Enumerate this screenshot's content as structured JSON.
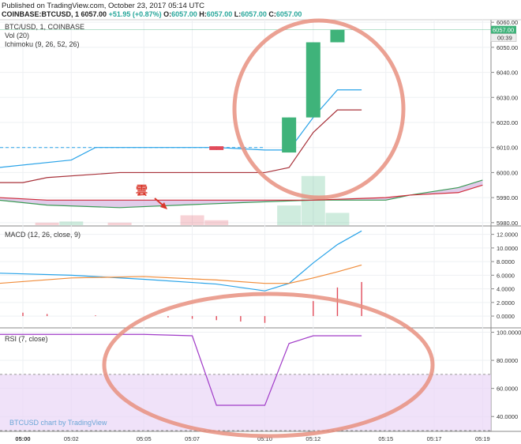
{
  "header": {
    "published": "Published on TradingView.com, October 23, 2017 05:14 UTC",
    "symbol": "COINBASE:BTCUSD, 1",
    "last": "6057.00",
    "change": "+51.95 (+0.87%)",
    "o_label": "O:",
    "o": "6057.00",
    "h_label": "H:",
    "h": "6057.00",
    "l_label": "L:",
    "l": "6057.00",
    "c_label": "C:",
    "c": "6057.00"
  },
  "price_pane": {
    "legend": [
      "BTC/USD, 1, COINBASE",
      "Vol (20)",
      "Ichimoku (9, 26, 52, 26)"
    ],
    "annotation": "雲",
    "price_tag": "6057.00",
    "countdown_tag": "00:39"
  },
  "macd_pane": {
    "legend": "MACD (12, 26, close, 9)"
  },
  "rsi_pane": {
    "legend": "RSI (7, close)"
  },
  "watermark": "BTCUSD chart by TradingView",
  "colors": {
    "up": "#3fb37a",
    "down": "#e14b5a",
    "tenkan": "#29a3e8",
    "kijun": "#a8323a",
    "cloud_fill": "#c9a3d8",
    "macd": "#29a3e8",
    "signal": "#f08c3a",
    "rsi": "#a13cc8",
    "highlight": "#e89080"
  },
  "chart_data": [
    {
      "type": "candlestick",
      "name": "price",
      "x": [
        "05:00",
        "05:01",
        "05:02",
        "05:03",
        "05:04",
        "05:05",
        "05:06",
        "05:07",
        "05:08",
        "05:09",
        "05:10",
        "05:11",
        "05:12",
        "05:13",
        "05:14"
      ],
      "x_ticks": [
        "05:00",
        "05:02",
        "05:05",
        "05:07",
        "05:10",
        "05:12",
        "05:15",
        "05:17",
        "05:19"
      ],
      "y_ticks": [
        5980,
        5990,
        6000,
        6010,
        6020,
        6030,
        6040,
        6050,
        6060
      ],
      "ylim": [
        5979,
        6061
      ],
      "candles": [
        {
          "t": "05:08",
          "o": 6010.5,
          "h": 6010.5,
          "l": 6009,
          "c": 6009
        },
        {
          "t": "05:11",
          "o": 6008,
          "h": 6022,
          "l": 6008,
          "c": 6022
        },
        {
          "t": "05:12",
          "o": 6022,
          "h": 6052,
          "l": 6022,
          "c": 6052
        },
        {
          "t": "05:13",
          "o": 6052,
          "h": 6057,
          "l": 6052,
          "c": 6057
        }
      ],
      "last_price": 6057.0,
      "tenkan": {
        "t": [
          "04:59",
          "05:02",
          "05:03",
          "05:08",
          "05:10",
          "05:11",
          "05:12",
          "05:13",
          "05:14"
        ],
        "v": [
          6002,
          6005,
          6010,
          6010,
          6009,
          6009,
          6022,
          6033,
          6033
        ]
      },
      "kijun": {
        "t": [
          "04:59",
          "05:00",
          "05:01",
          "05:04",
          "05:10",
          "05:11",
          "05:12",
          "05:13",
          "05:14"
        ],
        "v": [
          5996,
          5996,
          5998,
          6000,
          6000,
          6002,
          6016,
          6025,
          6025
        ]
      },
      "senkou_a": {
        "t": [
          "04:59",
          "05:01",
          "05:04",
          "05:09",
          "05:12",
          "05:15",
          "05:16",
          "05:18",
          "05:19"
        ],
        "v": [
          5989,
          5987,
          5986,
          5988,
          5989,
          5989,
          5991,
          5994,
          5997
        ]
      },
      "senkou_b": {
        "t": [
          "04:59",
          "05:01",
          "05:04",
          "05:09",
          "05:12",
          "05:15",
          "05:16",
          "05:18",
          "05:19"
        ],
        "v": [
          5990,
          5989,
          5989,
          5989,
          5989,
          5990,
          5991,
          5992,
          5995
        ]
      },
      "volume": [
        {
          "t": "05:01",
          "v": 2,
          "dir": "down"
        },
        {
          "t": "05:02",
          "v": 3,
          "dir": "up"
        },
        {
          "t": "05:04",
          "v": 2,
          "dir": "down"
        },
        {
          "t": "05:07",
          "v": 8,
          "dir": "down"
        },
        {
          "t": "05:08",
          "v": 4,
          "dir": "down"
        },
        {
          "t": "05:11",
          "v": 16,
          "dir": "up"
        },
        {
          "t": "05:12",
          "v": 40,
          "dir": "up"
        },
        {
          "t": "05:13",
          "v": 10,
          "dir": "up"
        }
      ]
    },
    {
      "type": "line",
      "name": "macd",
      "y_ticks": [
        0,
        2,
        4,
        6,
        8,
        10,
        12
      ],
      "ylim": [
        -1.5,
        13
      ],
      "macd": {
        "t": [
          "04:59",
          "05:02",
          "05:05",
          "05:08",
          "05:10",
          "05:11",
          "05:12",
          "05:13",
          "05:14"
        ],
        "v": [
          6.3,
          6.0,
          5.4,
          4.7,
          3.7,
          4.8,
          7.8,
          10.5,
          12.5
        ]
      },
      "signal": {
        "t": [
          "04:59",
          "05:02",
          "05:05",
          "05:08",
          "05:10",
          "05:11",
          "05:12",
          "05:13",
          "05:14"
        ],
        "v": [
          4.8,
          5.6,
          5.8,
          5.3,
          4.8,
          4.8,
          5.6,
          6.5,
          7.5
        ]
      },
      "histogram": [
        {
          "t": "05:00",
          "v": 0.5
        },
        {
          "t": "05:01",
          "v": 0.3
        },
        {
          "t": "05:03",
          "v": 0.1
        },
        {
          "t": "05:06",
          "v": -0.2
        },
        {
          "t": "05:07",
          "v": -0.4
        },
        {
          "t": "05:08",
          "v": -0.6
        },
        {
          "t": "05:09",
          "v": -0.8
        },
        {
          "t": "05:10",
          "v": -1.0
        },
        {
          "t": "05:12",
          "v": 2.2
        },
        {
          "t": "05:13",
          "v": 4.2
        },
        {
          "t": "05:14",
          "v": 5.0
        }
      ]
    },
    {
      "type": "line",
      "name": "rsi",
      "y_ticks": [
        40,
        60,
        80,
        100
      ],
      "ylim": [
        30,
        102
      ],
      "band": [
        30,
        70
      ],
      "rsi": {
        "t": [
          "04:59",
          "05:05",
          "05:07",
          "05:08",
          "05:10",
          "05:11",
          "05:12",
          "05:14"
        ],
        "v": [
          98.5,
          98.5,
          97.5,
          48,
          48,
          92,
          97.5,
          97.5
        ]
      }
    }
  ]
}
